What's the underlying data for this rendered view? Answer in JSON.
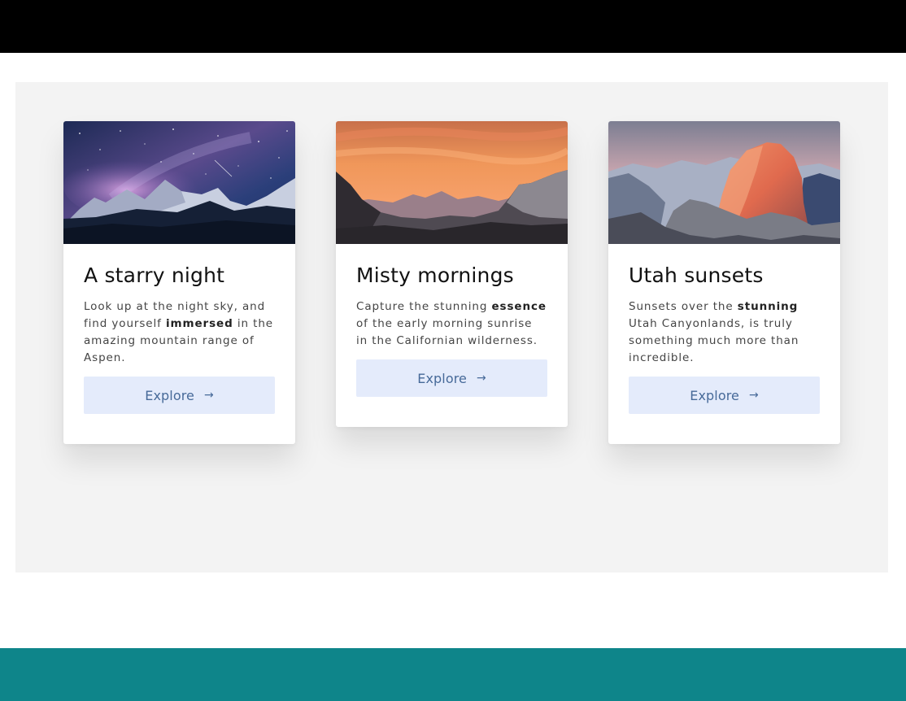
{
  "cards": [
    {
      "title": "A starry night",
      "text_before": "Look up at the night sky, and find yourself ",
      "text_bold": "immersed",
      "text_after": " in the amazing mountain range of Aspen.",
      "button_label": "Explore",
      "image_icon": "starry-mountain-photo"
    },
    {
      "title": "Misty mornings",
      "text_before": "Capture the stunning ",
      "text_bold": "essence",
      "text_after": " of the early morning sunrise in the Californian wilderness.",
      "button_label": "Explore",
      "image_icon": "sunrise-mountain-photo"
    },
    {
      "title": "Utah sunsets",
      "text_before": "Sunsets over the ",
      "text_bold": "stunning",
      "text_after": " Utah Canyonlands, is truly something much more than incredible.",
      "button_label": "Explore",
      "image_icon": "half-dome-sunset-photo"
    }
  ],
  "colors": {
    "top_bar": "#000000",
    "bottom_bar": "#0e858a",
    "panel_background": "#f3f3f3",
    "button_background": "#e4ebfb",
    "button_text": "#476a99"
  }
}
